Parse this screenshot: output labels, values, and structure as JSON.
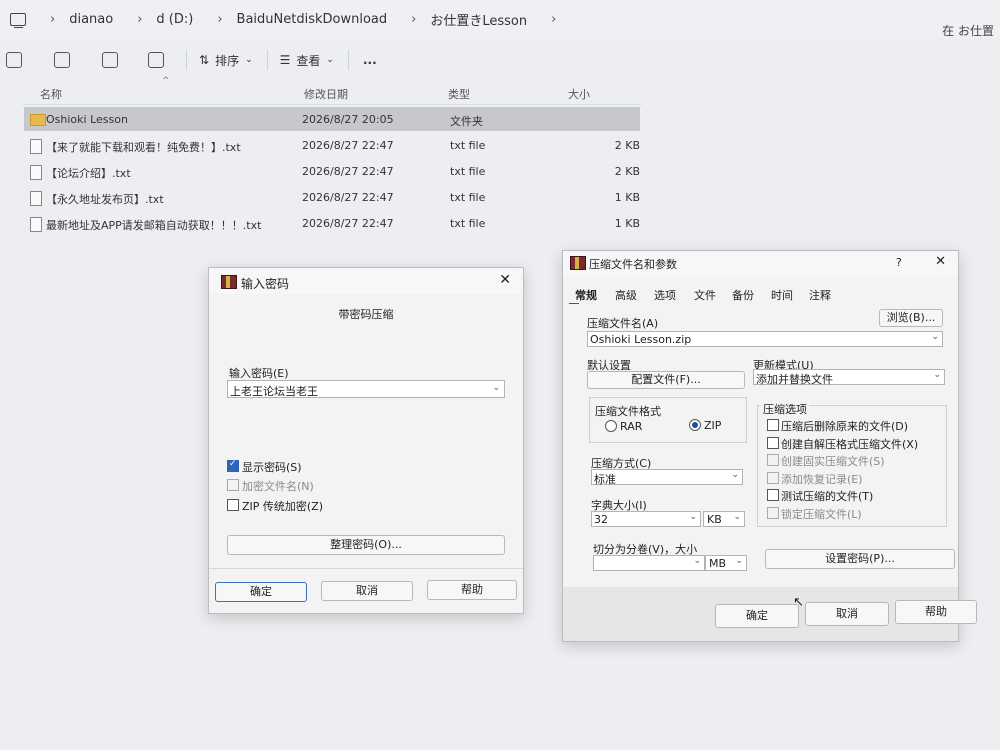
{
  "explorer": {
    "breadcrumbs": [
      "dianao",
      "d (D:)",
      "BaiduNetdiskDownload",
      "お仕置きLesson"
    ],
    "search_hint": "在 お仕置",
    "toolbar": {
      "sort_label": "排序",
      "view_label": "查看",
      "more_label": "..."
    },
    "columns": {
      "name": "名称",
      "date": "修改日期",
      "type": "类型",
      "size": "大小"
    },
    "files": [
      {
        "name": "Oshioki Lesson",
        "date": "2026/8/27 20:05",
        "type": "文件夹",
        "size": "",
        "folder": true,
        "selected": true
      },
      {
        "name": "【来了就能下载和观看！纯免费！】.txt",
        "date": "2026/8/27 22:47",
        "type": "txt file",
        "size": "2 KB"
      },
      {
        "name": "【论坛介绍】.txt",
        "date": "2026/8/27 22:47",
        "type": "txt file",
        "size": "2 KB"
      },
      {
        "name": "【永久地址发布页】.txt",
        "date": "2026/8/27 22:47",
        "type": "txt file",
        "size": "1 KB"
      },
      {
        "name": "最新地址及APP请发邮箱自动获取！！！.txt",
        "date": "2026/8/27 22:47",
        "type": "txt file",
        "size": "1 KB"
      }
    ]
  },
  "pwd_dialog": {
    "title": "输入密码",
    "subtitle": "带密码压缩",
    "input_label": "输入密码(E)",
    "input_value": "上老王论坛当老王",
    "options": [
      {
        "label": "显示密码(S)",
        "checked": true,
        "disabled": false
      },
      {
        "label": "加密文件名(N)",
        "checked": false,
        "disabled": true
      },
      {
        "label": "ZIP 传统加密(Z)",
        "checked": false,
        "disabled": false
      }
    ],
    "organize_label": "整理密码(O)...",
    "ok_label": "确定",
    "cancel_label": "取消",
    "help_label": "帮助",
    "close_label": "✕"
  },
  "archive_dialog": {
    "title": "压缩文件名和参数",
    "help_q": "?",
    "close_label": "✕",
    "tabs": [
      "常规",
      "高级",
      "选项",
      "文件",
      "备份",
      "时间",
      "注释"
    ],
    "filename_label": "压缩文件名(A)",
    "filename_value": "Oshioki Lesson.zip",
    "browse_label": "浏览(B)...",
    "default_label": "默认设置",
    "profile_label": "配置文件(F)...",
    "update_label": "更新模式(U)",
    "update_value": "添加并替换文件",
    "format_label": "压缩文件格式",
    "format_rar": "RAR",
    "format_zip": "ZIP",
    "method_label": "压缩方式(C)",
    "method_value": "标准",
    "dict_label": "字典大小(I)",
    "dict_value": "32",
    "dict_unit": "KB",
    "split_label": "切分为分卷(V)，大小",
    "split_unit": "MB",
    "options_label": "压缩选项",
    "options": [
      {
        "label": "压缩后删除原来的文件(D)",
        "disabled": false
      },
      {
        "label": "创建自解压格式压缩文件(X)",
        "disabled": false
      },
      {
        "label": "创建固实压缩文件(S)",
        "disabled": true
      },
      {
        "label": "添加恢复记录(E)",
        "disabled": true
      },
      {
        "label": "测试压缩的文件(T)",
        "disabled": false
      },
      {
        "label": "锁定压缩文件(L)",
        "disabled": true
      }
    ],
    "set_password_label": "设置密码(P)...",
    "ok_label": "确定",
    "cancel_label": "取消",
    "help_label": "帮助"
  }
}
